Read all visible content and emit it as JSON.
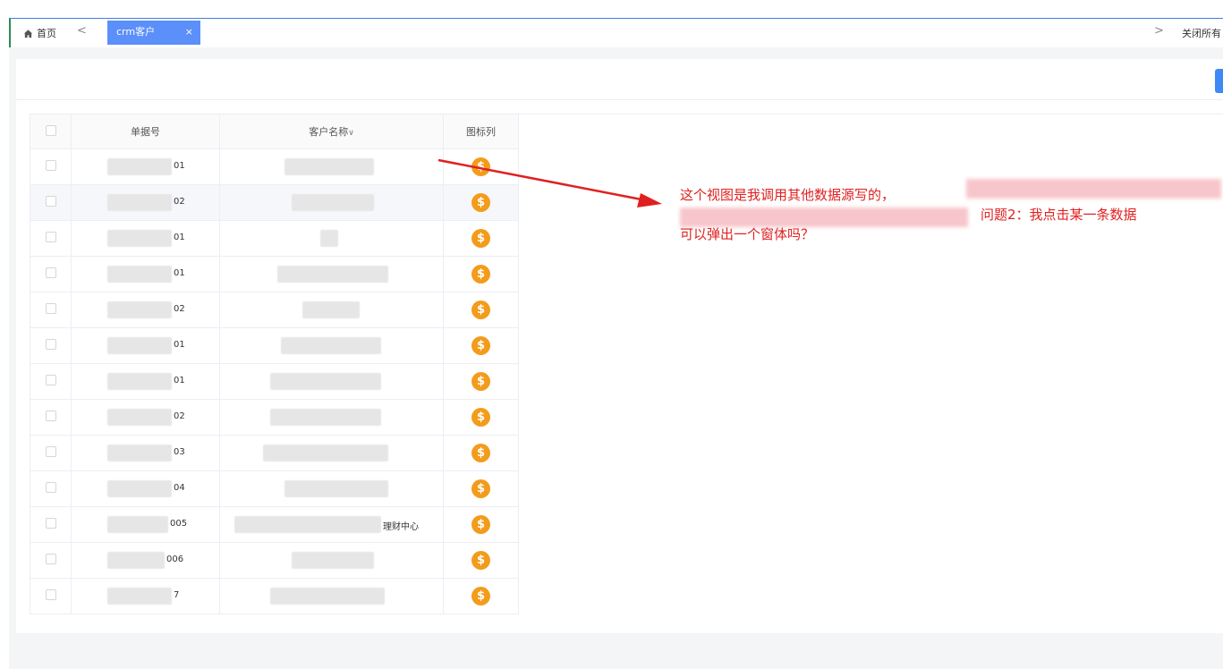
{
  "tabs": {
    "home_label": "首页",
    "prev_arrow": "<",
    "next_arrow": ">",
    "active_label": "crm客户",
    "active_close": "×",
    "close_all": "关闭所有"
  },
  "table": {
    "columns": [
      "单据号",
      "客户名称",
      "图标列"
    ],
    "sort_caret": "∨",
    "rows": [
      {
        "no_suffix": "01",
        "name_suffix": "",
        "coin": "$"
      },
      {
        "no_suffix": "02",
        "name_suffix": "",
        "coin": "$"
      },
      {
        "no_suffix": "01",
        "name_suffix": "",
        "coin": "$"
      },
      {
        "no_suffix": "01",
        "name_suffix": "",
        "coin": "$"
      },
      {
        "no_suffix": "02",
        "name_suffix": "",
        "coin": "$"
      },
      {
        "no_suffix": "01",
        "name_suffix": "",
        "coin": "$"
      },
      {
        "no_suffix": "01",
        "name_suffix": "",
        "coin": "$"
      },
      {
        "no_suffix": "02",
        "name_suffix": "",
        "coin": "$"
      },
      {
        "no_suffix": "03",
        "name_suffix": "",
        "coin": "$"
      },
      {
        "no_suffix": "04",
        "name_suffix": "",
        "coin": "$"
      },
      {
        "no_suffix": "005",
        "name_suffix": "理财中心",
        "coin": "$"
      },
      {
        "no_suffix": "006",
        "name_suffix": "",
        "coin": "$"
      },
      {
        "no_suffix": "7",
        "name_suffix": "",
        "coin": "$"
      }
    ]
  },
  "annotation": {
    "line1": "这个视图是我调用其他数据源写的，",
    "line2": "问题2：我点击某一条数据",
    "line3": "可以弹出一个窗体吗？"
  },
  "colors": {
    "accent": "#5b8ff9",
    "coin": "#f39c1b",
    "annotation": "#e02020"
  }
}
